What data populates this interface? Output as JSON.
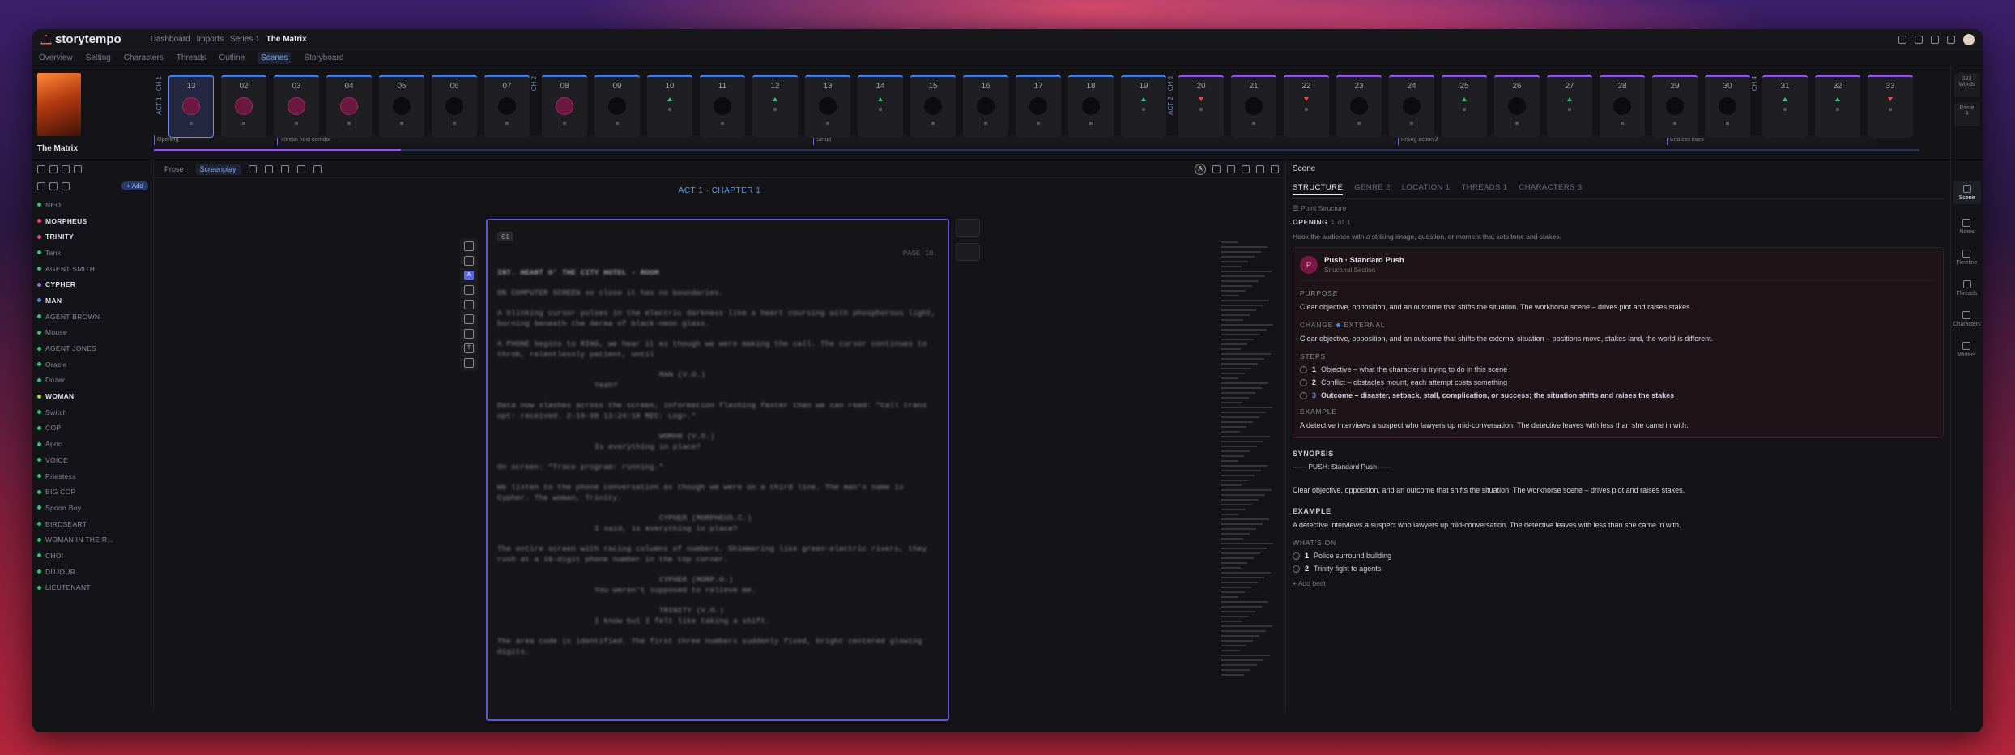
{
  "app": {
    "name": "storytempo"
  },
  "breadcrumbs": [
    "Dashboard",
    "Imports",
    "Series 1",
    "The Matrix"
  ],
  "nav_tabs": [
    "Overview",
    "Setting",
    "Characters",
    "Threads",
    "Outline",
    "Scenes",
    "Storyboard"
  ],
  "nav_active": 5,
  "poster": {
    "title": "The Matrix"
  },
  "timeline": {
    "cards": [
      {
        "n": "13",
        "mark": "pink",
        "sel": true
      },
      {
        "n": "02",
        "mark": "pink"
      },
      {
        "n": "03",
        "mark": "pink"
      },
      {
        "n": "04",
        "mark": "pink"
      },
      {
        "n": "05",
        "mark": "dot"
      },
      {
        "n": "06",
        "mark": "dot"
      },
      {
        "n": "07",
        "mark": "dot"
      },
      {
        "n": "08",
        "mark": "pink"
      },
      {
        "n": "09",
        "mark": "dot"
      },
      {
        "n": "10",
        "mark": "up"
      },
      {
        "n": "11",
        "mark": "dot"
      },
      {
        "n": "12",
        "mark": "up"
      },
      {
        "n": "13",
        "mark": "dot"
      },
      {
        "n": "14",
        "mark": "up"
      },
      {
        "n": "15",
        "mark": "dot"
      },
      {
        "n": "16",
        "mark": "dot"
      },
      {
        "n": "17",
        "mark": "dot"
      },
      {
        "n": "18",
        "mark": "dot"
      },
      {
        "n": "19",
        "mark": "up"
      },
      {
        "n": "20",
        "mark": "down",
        "purple": true
      },
      {
        "n": "21",
        "mark": "dot",
        "purple": true
      },
      {
        "n": "22",
        "mark": "down",
        "purple": true
      },
      {
        "n": "23",
        "mark": "dot",
        "purple": true
      },
      {
        "n": "24",
        "mark": "dot",
        "purple": true
      },
      {
        "n": "25",
        "mark": "up",
        "purple": true
      },
      {
        "n": "26",
        "mark": "dot",
        "purple": true
      },
      {
        "n": "27",
        "mark": "up",
        "purple": true
      },
      {
        "n": "28",
        "mark": "dot",
        "purple": true
      },
      {
        "n": "29",
        "mark": "dot",
        "purple": true
      },
      {
        "n": "30",
        "mark": "dot",
        "purple": true
      },
      {
        "n": "31",
        "mark": "up",
        "purple": true
      },
      {
        "n": "32",
        "mark": "up",
        "purple": true
      },
      {
        "n": "33",
        "mark": "down",
        "purple": true
      }
    ],
    "act_labels": [
      "ACT 1 · CH 1",
      "CH 2",
      "ACT 2 · CH 3",
      "CH 4"
    ],
    "beats": [
      "Opening",
      "Thresh hold corridor",
      "Setup",
      "Rising action 2",
      "Endless rises"
    ],
    "progress": 0.14,
    "right": [
      {
        "top": "283",
        "bottom": "Words"
      },
      {
        "top": "Paste",
        "bottom": "4"
      }
    ]
  },
  "editor": {
    "modes": [
      "Prose",
      "Screenplay"
    ],
    "mode_active": 1,
    "act_heading": "ACT 1 · CHAPTER 1",
    "page_tag": "S1",
    "page_number": "PAGE 10.",
    "lines": [
      {
        "t": "heading",
        "v": "INT. HEART O' THE CITY HOTEL - ROOM"
      },
      {
        "t": "action",
        "v": "ON COMPUTER SCREEN so close it has no boundaries."
      },
      {
        "t": "action",
        "v": "A blinking cursor pulses in the electric darkness like a heart coursing with phosphorous light, burning beneath the derma of black-neon glass."
      },
      {
        "t": "action",
        "v": "A PHONE begins to RING, we hear it as though we were making the call. The cursor continues to throb, relentlessly patient, until"
      },
      {
        "t": "char",
        "v": "MAN (V.O.)"
      },
      {
        "t": "dialog",
        "v": "Yeah?"
      },
      {
        "t": "action",
        "v": "Data now slashes across the screen, information flashing faster than we can read: \"Call trans opt: received. 2-19-98 13:24:18 REC: Log>.\""
      },
      {
        "t": "char",
        "v": "WOMAN (V.O.)"
      },
      {
        "t": "dialog",
        "v": "Is everything in place?"
      },
      {
        "t": "action",
        "v": "On screen: \"Trace program: running.\""
      },
      {
        "t": "action",
        "v": "We listen to the phone conversation as though we were on a third line. The man's name is Cypher. The woman, Trinity."
      },
      {
        "t": "char",
        "v": "CYPHER (MORPHEUS.C.)"
      },
      {
        "t": "dialog",
        "v": "I said, is everything in place?"
      },
      {
        "t": "action",
        "v": "The entire screen with racing columns of numbers. Shimmering like green-electric rivers, they rush at a 10-digit phone number in the top corner."
      },
      {
        "t": "char",
        "v": "CYPHER (MORP.O.)"
      },
      {
        "t": "dialog",
        "v": "You weren't supposed to relieve me."
      },
      {
        "t": "char",
        "v": "TRINITY (V.O.)"
      },
      {
        "t": "dialog",
        "v": "I know but I felt like taking a shift."
      },
      {
        "t": "action",
        "v": "The area code is identified. The first three numbers suddenly fixed, bright centered glowing digits."
      }
    ]
  },
  "characters": {
    "items": [
      {
        "name": "NEO",
        "c": "#3ac070",
        "hi": false
      },
      {
        "name": "MORPHEUS",
        "c": "#e84a6a",
        "hi": true
      },
      {
        "name": "TRINITY",
        "c": "#e84a9a",
        "hi": true
      },
      {
        "name": "Tank",
        "c": "#3ac070",
        "hi": false
      },
      {
        "name": "AGENT SMITH",
        "c": "#3ac070",
        "hi": false
      },
      {
        "name": "CYPHER",
        "c": "#9a6ae8",
        "hi": true
      },
      {
        "name": "MAN",
        "c": "#4a8ae8",
        "hi": true
      },
      {
        "name": "AGENT BROWN",
        "c": "#3ac070",
        "hi": false
      },
      {
        "name": "Mouse",
        "c": "#3ac070",
        "hi": false
      },
      {
        "name": "AGENT JONES",
        "c": "#3ac070",
        "hi": false
      },
      {
        "name": "Oracle",
        "c": "#3ac070",
        "hi": false
      },
      {
        "name": "Dozer",
        "c": "#3ac070",
        "hi": false
      },
      {
        "name": "WOMAN",
        "c": "#a0e040",
        "hi": true
      },
      {
        "name": "Switch",
        "c": "#3ac070",
        "hi": false
      },
      {
        "name": "COP",
        "c": "#3ac070",
        "hi": false
      },
      {
        "name": "Apoc",
        "c": "#3ac070",
        "hi": false
      },
      {
        "name": "VOICE",
        "c": "#3ac070",
        "hi": false
      },
      {
        "name": "Priestess",
        "c": "#3ac070",
        "hi": false
      },
      {
        "name": "BIG COP",
        "c": "#3ac070",
        "hi": false
      },
      {
        "name": "Spoon Boy",
        "c": "#3ac070",
        "hi": false
      },
      {
        "name": "BIRDSEART",
        "c": "#3ac070",
        "hi": false
      },
      {
        "name": "WOMAN IN THE R...",
        "c": "#3ac070",
        "hi": false
      },
      {
        "name": "CHOI",
        "c": "#3ac070",
        "hi": false
      },
      {
        "name": "DUJOUR",
        "c": "#3ac070",
        "hi": false
      },
      {
        "name": "LIEUTENANT",
        "c": "#3ac070",
        "hi": false
      }
    ],
    "add_label": "+ Add"
  },
  "inspector": {
    "header": "Scene",
    "tabs": [
      "STRUCTURE",
      "GENRE 2",
      "LOCATION 1",
      "THREADS 1",
      "CHARACTERS 3"
    ],
    "tab_active": 0,
    "point_structure": "Point Structure",
    "opening_label": "OPENING",
    "opening_count": "1 of 1",
    "opening_desc": "Hook the audience with a striking image, question, or moment that sets tone and stakes.",
    "beat_title": "Push · Standard Push",
    "beat_sub": "Structural Section",
    "purpose_label": "PURPOSE",
    "purpose_text": "Clear objective, opposition, and an outcome that shifts the situation. The workhorse scene – drives plot and raises stakes.",
    "change_label": "CHANGE",
    "change_type": "EXTERNAL",
    "change_text": "Clear objective, opposition, and an outcome that shifts the external situation – positions move, stakes land, the world is different.",
    "steps_label": "STEPS",
    "steps": [
      {
        "n": "1",
        "t": "Objective – what the character is trying to do in this scene"
      },
      {
        "n": "2",
        "t": "Conflict – obstacles mount, each attempt costs something"
      },
      {
        "n": "3",
        "t": "Outcome – disaster, setback, stall, complication, or success; the situation shifts and raises the stakes"
      }
    ],
    "example_label": "EXAMPLE",
    "example_text": "A detective interviews a suspect who lawyers up mid-conversation. The detective leaves with less than she came in with.",
    "synopsis_label": "SYNOPSIS",
    "synopsis_sub": "—— PUSH: Standard Push ——",
    "synopsis_text": "Clear objective, opposition, and an outcome that shifts the situation. The workhorse scene – drives plot and raises stakes.",
    "examples_label": "EXAMPLE",
    "examples_text": "A detective interviews a suspect who lawyers up mid-conversation. The detective leaves with less than she came in with.",
    "whats_label": "WHAT'S ON",
    "whats": [
      {
        "n": "1",
        "t": "Police surround building"
      },
      {
        "n": "2",
        "t": "Trinity fight to agents"
      }
    ],
    "add_beat": "+ Add beat"
  },
  "rail": [
    "Scene",
    "Notes",
    "Timeline",
    "Threads",
    "Characters",
    "Writers"
  ],
  "rail_active": 0
}
